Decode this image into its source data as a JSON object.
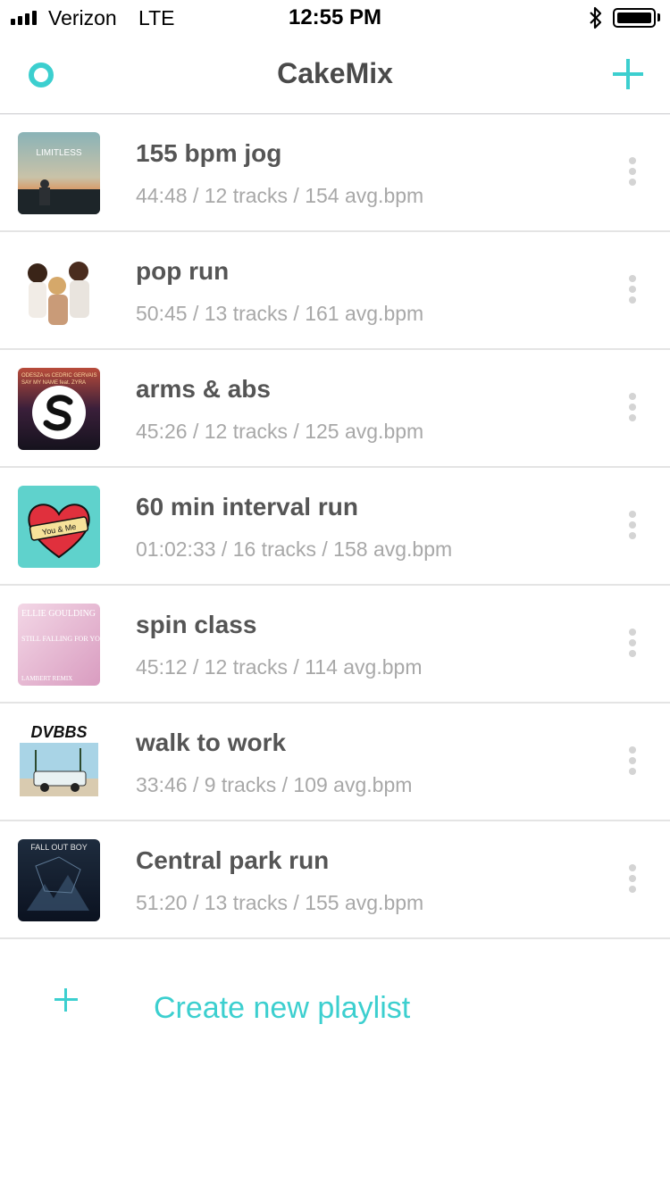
{
  "status_bar": {
    "carrier": "Verizon",
    "network": "LTE",
    "time": "12:55 PM",
    "bluetooth_icon": "bluetooth-icon",
    "battery_icon": "battery-full-icon"
  },
  "nav": {
    "title": "CakeMix",
    "left_icon": "ring-icon",
    "right_icon": "plus-icon",
    "accent_color": "#3ccfcf"
  },
  "playlists": [
    {
      "title": "155 bpm jog",
      "meta": "44:48 / 12 tracks / 154 avg.bpm",
      "art": "limitless-album-art"
    },
    {
      "title": "pop run",
      "meta": "50:45 / 13 tracks / 161 avg.bpm",
      "art": "trio-group-album-art"
    },
    {
      "title": "arms & abs",
      "meta": "45:26 / 12 tracks / 125 avg.bpm",
      "art": "odesza-say-my-name-album-art"
    },
    {
      "title": "60 min interval run",
      "meta": "01:02:33 / 16 tracks / 158 avg.bpm",
      "art": "heart-you-and-me-album-art"
    },
    {
      "title": "spin class",
      "meta": "45:12 / 12 tracks / 114 avg.bpm",
      "art": "ellie-goulding-album-art"
    },
    {
      "title": "walk to work",
      "meta": "33:46 / 9 tracks / 109 avg.bpm",
      "art": "dvbbs-album-art"
    },
    {
      "title": "Central park run",
      "meta": "51:20 / 13 tracks / 155 avg.bpm",
      "art": "fall-out-boy-album-art"
    }
  ],
  "art_text": {
    "limitless": "LIMITLESS",
    "odesza": "ODESZA vs CEDRIC GERVAIS",
    "say_my_name": "SAY MY NAME feat. ZYRA",
    "you_and_me": "You & Me",
    "ellie": "ELLIE GOULDING",
    "ellie_song": "STILL FALLING FOR YOU",
    "lambert": "LAMBERT REMIX",
    "dvbbs": "DVBBS",
    "fob": "FALL OUT BOY"
  },
  "create": {
    "label": "Create new playlist",
    "icon": "plus-icon"
  }
}
